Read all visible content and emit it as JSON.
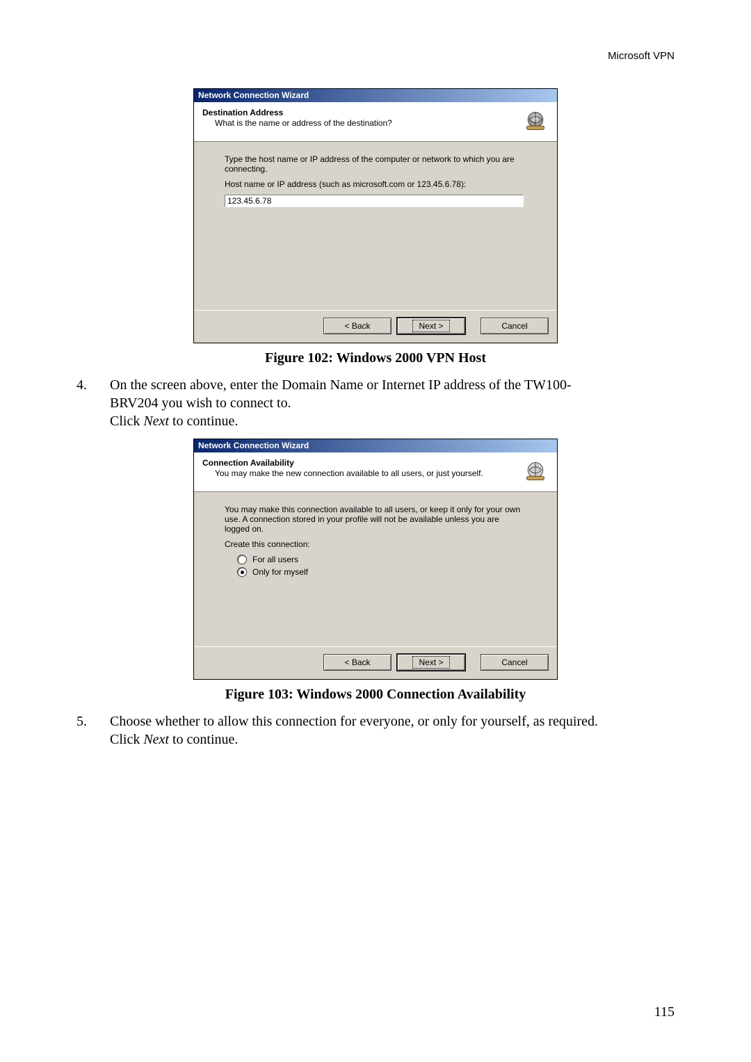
{
  "header": {
    "right": "Microsoft VPN"
  },
  "footer": {
    "page": "115"
  },
  "captions": {
    "fig102": "Figure 102: Windows 2000 VPN Host",
    "fig103": "Figure 103: Windows 2000 Connection Availability"
  },
  "step4": {
    "num": "4.",
    "line1a": "On the screen above, enter the Domain Name or Internet IP address of the TW100-",
    "line1b": "BRV204  you wish to connect to.",
    "line2a": "Click ",
    "line2_italic": "Next",
    "line2b": " to continue."
  },
  "step5": {
    "num": "5.",
    "line1": "Choose whether to allow this connection for everyone, or only for yourself, as required.",
    "line2a": "Click ",
    "line2_italic": "Next",
    "line2b": " to continue."
  },
  "dialog1": {
    "title": "Network Connection Wizard",
    "banner_heading": "Destination Address",
    "banner_sub": "What is the name or address of the destination?",
    "para1": "Type the host name or IP address of the computer or network to which you are connecting.",
    "label": "Host name or IP address (such as microsoft.com or 123.45.6.78):",
    "value": "123.45.6.78",
    "back": "< Back",
    "next": "Next >",
    "cancel": "Cancel"
  },
  "dialog2": {
    "title": "Network Connection Wizard",
    "banner_heading": "Connection Availability",
    "banner_sub": "You may make the new connection available to all users, or just yourself.",
    "para1": "You may make this connection available to all users, or keep it only for your own use.  A connection stored in your profile will not be available unless you are logged on.",
    "group_label": "Create this connection:",
    "opt_all": "For all users",
    "opt_self": "Only for myself",
    "back": "< Back",
    "next": "Next >",
    "cancel": "Cancel"
  }
}
